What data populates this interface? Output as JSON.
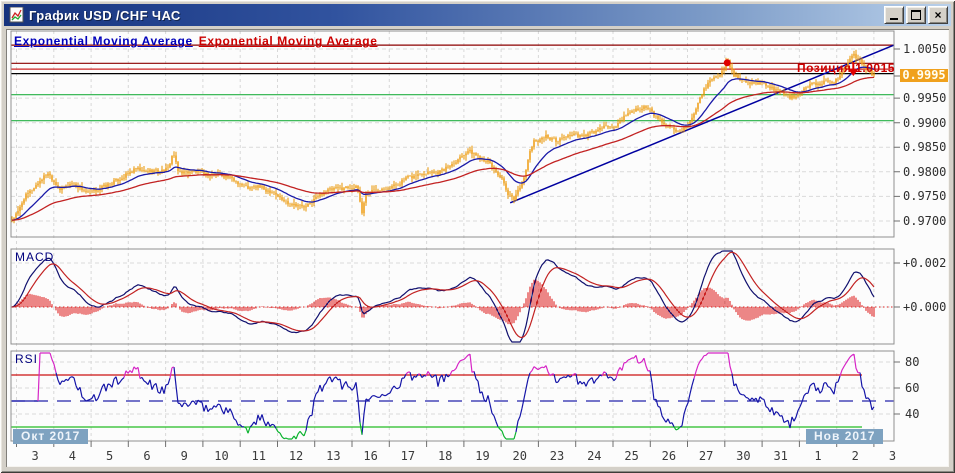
{
  "window": {
    "title": "График USD /CHF ЧАС",
    "controls": {
      "minimize": "minimize",
      "maximize": "maximize",
      "close": "×"
    }
  },
  "legend": {
    "ema_fast": "Exponential Moving Average",
    "ema_slow": "Exponential Moving Average",
    "ema_fast_color": "#0000bb",
    "ema_slow_color": "#cc0000"
  },
  "position_marker": {
    "label": "Позиция",
    "value": "1.0015",
    "color": "#cc0000"
  },
  "x_axis": {
    "day_labels": [
      "3",
      "4",
      "5",
      "6",
      "9",
      "10",
      "11",
      "12",
      "13",
      "16",
      "17",
      "18",
      "19",
      "20",
      "23",
      "24",
      "25",
      "26",
      "27",
      "30",
      "31",
      "1",
      "2",
      "3"
    ],
    "month_badges": [
      {
        "label": "Окт 2017"
      },
      {
        "label": "Нов 2017"
      }
    ],
    "badge_bg": "#7ea2c0"
  },
  "chart_data": [
    {
      "id": "price",
      "type": "candlestick",
      "symbol": "USD/CHF",
      "timeframe": "hourly",
      "y_tick_labels": [
        "1.0050",
        "0.9950",
        "0.9900",
        "0.9850",
        "0.9800",
        "0.9750",
        "0.9700"
      ],
      "current_price_label": "0.9995",
      "current_price": 0.9995,
      "candle_color": "#f0a11d",
      "ema_fast_period": 18,
      "ema_slow_period": 55,
      "ema_fast_color": "#1a1aa8",
      "ema_slow_color": "#c22222",
      "trendline": {
        "from": {
          "xf": 0.566,
          "price": 0.9737
        },
        "to": {
          "xf": 1.012,
          "price": 1.0066
        },
        "color": "#0000a0"
      },
      "h_lines": [
        {
          "price": 1.0058,
          "color": "#8b0000"
        },
        {
          "price": 1.0021,
          "color": "#8b0000"
        },
        {
          "price": 1.0009,
          "color": "#cc2222"
        },
        {
          "price": 1.0,
          "color": "#000000"
        },
        {
          "price": 0.9957,
          "color": "#25b045"
        },
        {
          "price": 0.9904,
          "color": "#25b045"
        }
      ],
      "markers": [
        {
          "xf": 0.812,
          "price": 1.0022,
          "shape": "dot",
          "color": "#e00000"
        },
        {
          "xf": 0.955,
          "price": 1.0013,
          "shape": "arrow-down",
          "color": "#e00000"
        }
      ],
      "close_path": [
        [
          0.0,
          0.97
        ],
        [
          0.008,
          0.9718
        ],
        [
          0.015,
          0.9748
        ],
        [
          0.022,
          0.976
        ],
        [
          0.028,
          0.9772
        ],
        [
          0.035,
          0.9786
        ],
        [
          0.042,
          0.9798
        ],
        [
          0.049,
          0.978
        ],
        [
          0.056,
          0.9763
        ],
        [
          0.062,
          0.977
        ],
        [
          0.069,
          0.9777
        ],
        [
          0.078,
          0.9768
        ],
        [
          0.087,
          0.9757
        ],
        [
          0.096,
          0.9762
        ],
        [
          0.105,
          0.977
        ],
        [
          0.115,
          0.9778
        ],
        [
          0.124,
          0.9786
        ],
        [
          0.133,
          0.9796
        ],
        [
          0.142,
          0.9806
        ],
        [
          0.151,
          0.98
        ],
        [
          0.16,
          0.9803
        ],
        [
          0.169,
          0.9801
        ],
        [
          0.178,
          0.9806
        ],
        [
          0.184,
          0.984
        ],
        [
          0.189,
          0.9801
        ],
        [
          0.198,
          0.9799
        ],
        [
          0.208,
          0.9801
        ],
        [
          0.217,
          0.9797
        ],
        [
          0.226,
          0.9793
        ],
        [
          0.235,
          0.9796
        ],
        [
          0.244,
          0.9791
        ],
        [
          0.253,
          0.9783
        ],
        [
          0.262,
          0.9773
        ],
        [
          0.271,
          0.9766
        ],
        [
          0.28,
          0.9771
        ],
        [
          0.289,
          0.9763
        ],
        [
          0.298,
          0.9759
        ],
        [
          0.307,
          0.9743
        ],
        [
          0.316,
          0.9736
        ],
        [
          0.325,
          0.9733
        ],
        [
          0.334,
          0.9727
        ],
        [
          0.341,
          0.9739
        ],
        [
          0.348,
          0.9751
        ],
        [
          0.357,
          0.9761
        ],
        [
          0.366,
          0.9765
        ],
        [
          0.375,
          0.9767
        ],
        [
          0.384,
          0.9769
        ],
        [
          0.393,
          0.9767
        ],
        [
          0.398,
          0.9716
        ],
        [
          0.402,
          0.9757
        ],
        [
          0.412,
          0.9763
        ],
        [
          0.421,
          0.9767
        ],
        [
          0.43,
          0.9769
        ],
        [
          0.439,
          0.9775
        ],
        [
          0.448,
          0.9787
        ],
        [
          0.457,
          0.9791
        ],
        [
          0.466,
          0.9797
        ],
        [
          0.475,
          0.9801
        ],
        [
          0.484,
          0.9799
        ],
        [
          0.493,
          0.9807
        ],
        [
          0.502,
          0.9819
        ],
        [
          0.511,
          0.9833
        ],
        [
          0.518,
          0.9843
        ],
        [
          0.525,
          0.9837
        ],
        [
          0.532,
          0.9829
        ],
        [
          0.541,
          0.9821
        ],
        [
          0.55,
          0.9801
        ],
        [
          0.557,
          0.9783
        ],
        [
          0.563,
          0.9753
        ],
        [
          0.57,
          0.9745
        ],
        [
          0.577,
          0.9769
        ],
        [
          0.584,
          0.9801
        ],
        [
          0.588,
          0.9841
        ],
        [
          0.593,
          0.9861
        ],
        [
          0.6,
          0.9867
        ],
        [
          0.607,
          0.9873
        ],
        [
          0.613,
          0.9867
        ],
        [
          0.62,
          0.9863
        ],
        [
          0.627,
          0.9871
        ],
        [
          0.634,
          0.9875
        ],
        [
          0.641,
          0.9875
        ],
        [
          0.647,
          0.9871
        ],
        [
          0.654,
          0.9877
        ],
        [
          0.661,
          0.9881
        ],
        [
          0.668,
          0.9887
        ],
        [
          0.677,
          0.9893
        ],
        [
          0.684,
          0.9889
        ],
        [
          0.69,
          0.9903
        ],
        [
          0.697,
          0.9913
        ],
        [
          0.704,
          0.9925
        ],
        [
          0.711,
          0.9929
        ],
        [
          0.718,
          0.9931
        ],
        [
          0.724,
          0.9927
        ],
        [
          0.729,
          0.9915
        ],
        [
          0.734,
          0.9907
        ],
        [
          0.74,
          0.9899
        ],
        [
          0.747,
          0.9891
        ],
        [
          0.754,
          0.9885
        ],
        [
          0.761,
          0.9887
        ],
        [
          0.768,
          0.9893
        ],
        [
          0.772,
          0.9907
        ],
        [
          0.777,
          0.9927
        ],
        [
          0.781,
          0.9947
        ],
        [
          0.786,
          0.9967
        ],
        [
          0.79,
          0.9981
        ],
        [
          0.795,
          0.9989
        ],
        [
          0.799,
          0.9993
        ],
        [
          0.804,
          0.9997
        ],
        [
          0.808,
          1.0009
        ],
        [
          0.812,
          1.0033
        ],
        [
          0.815,
          1.0011
        ],
        [
          0.82,
          0.9997
        ],
        [
          0.824,
          0.9991
        ],
        [
          0.829,
          0.9985
        ],
        [
          0.836,
          0.9981
        ],
        [
          0.842,
          0.9979
        ],
        [
          0.849,
          0.9983
        ],
        [
          0.856,
          0.9977
        ],
        [
          0.863,
          0.9971
        ],
        [
          0.87,
          0.9965
        ],
        [
          0.876,
          0.9959
        ],
        [
          0.883,
          0.9953
        ],
        [
          0.89,
          0.9951
        ],
        [
          0.897,
          0.9963
        ],
        [
          0.904,
          0.9975
        ],
        [
          0.91,
          0.9981
        ],
        [
          0.917,
          0.9979
        ],
        [
          0.924,
          0.9983
        ],
        [
          0.931,
          0.9979
        ],
        [
          0.938,
          0.9989
        ],
        [
          0.942,
          1.0005
        ],
        [
          0.947,
          1.0019
        ],
        [
          0.951,
          1.0033
        ],
        [
          0.956,
          1.0039
        ],
        [
          0.96,
          1.0031
        ],
        [
          0.965,
          1.0019
        ],
        [
          0.969,
          1.0009
        ],
        [
          0.974,
          1.0003
        ],
        [
          0.979,
          0.9995
        ]
      ]
    },
    {
      "id": "macd",
      "label": "MACD",
      "type": "line+histogram",
      "y_tick_labels": [
        {
          "label": "+0.002",
          "value": 0.002
        },
        {
          "label": "+0.000",
          "value": 0.0
        }
      ],
      "derived_from": "close_path",
      "fast": 12,
      "slow": 26,
      "signal": 9,
      "line_color": "#10106e",
      "signal_color": "#c22222",
      "hist_color": "#dd1111",
      "zero_line_color": "#dd2222"
    },
    {
      "id": "rsi",
      "label": "RSI",
      "type": "line",
      "period": 14,
      "y_tick_labels": [
        "80",
        "60",
        "40"
      ],
      "levels": [
        {
          "value": 70,
          "color": "#cc1111",
          "style": "solid"
        },
        {
          "value": 50,
          "color": "#2222aa",
          "style": "dashed"
        },
        {
          "value": 30,
          "color": "#22bb22",
          "style": "solid"
        }
      ],
      "line_color": "#1616a8",
      "overbought_color": "#d626c6",
      "oversold_color": "#0cb32f"
    }
  ]
}
